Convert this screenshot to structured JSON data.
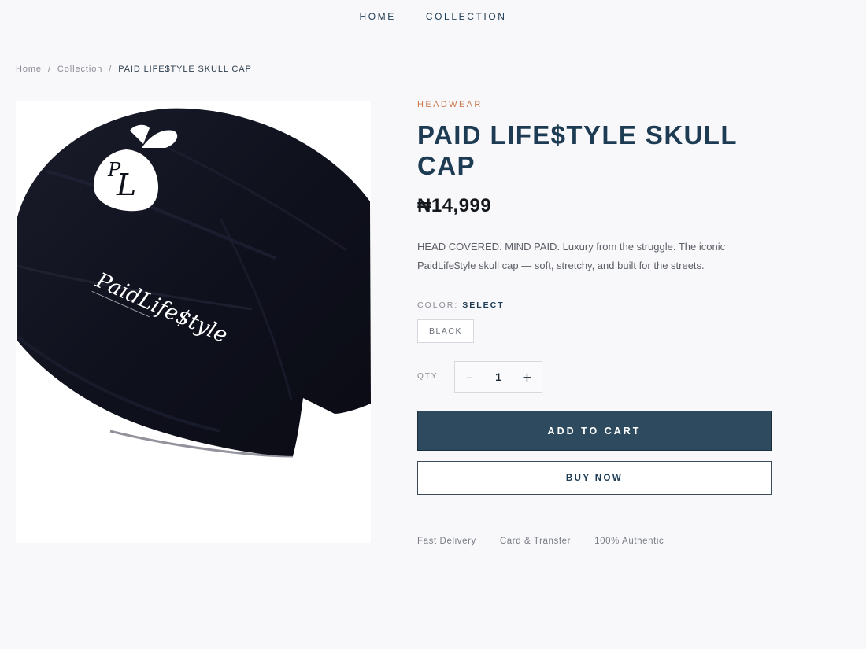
{
  "nav": {
    "links": [
      "HOME",
      "COLLECTION"
    ]
  },
  "breadcrumb": {
    "home": "Home",
    "separator": "/",
    "collection": "Collection",
    "current": "PAID LIFE$TYLE SKULL CAP"
  },
  "product": {
    "category": "HEADWEAR",
    "title": "PAID LIFE$TYLE SKULL CAP",
    "price": "₦14,999",
    "description": "HEAD COVERED. MIND PAID. Luxury from the struggle. The iconic PaidLife$tyle skull cap — soft, stretchy, and built for the streets.",
    "image_logo_text": "PaidLife$tyle"
  },
  "color": {
    "label": "COLOR:",
    "selected": "SELECT",
    "options": [
      "BLACK"
    ]
  },
  "quantity": {
    "label": "QTY:",
    "decrement": "–",
    "value": "1",
    "increment": "+"
  },
  "actions": {
    "add_to_cart": "ADD TO CART",
    "buy_now": "BUY NOW"
  },
  "features": [
    "Fast Delivery",
    "Card & Transfer",
    "100% Authentic"
  ],
  "colors": {
    "accent": "#c9784b",
    "primary": "#2d4a5e",
    "heading": "#1d3b52",
    "background": "#f8f8fb"
  }
}
